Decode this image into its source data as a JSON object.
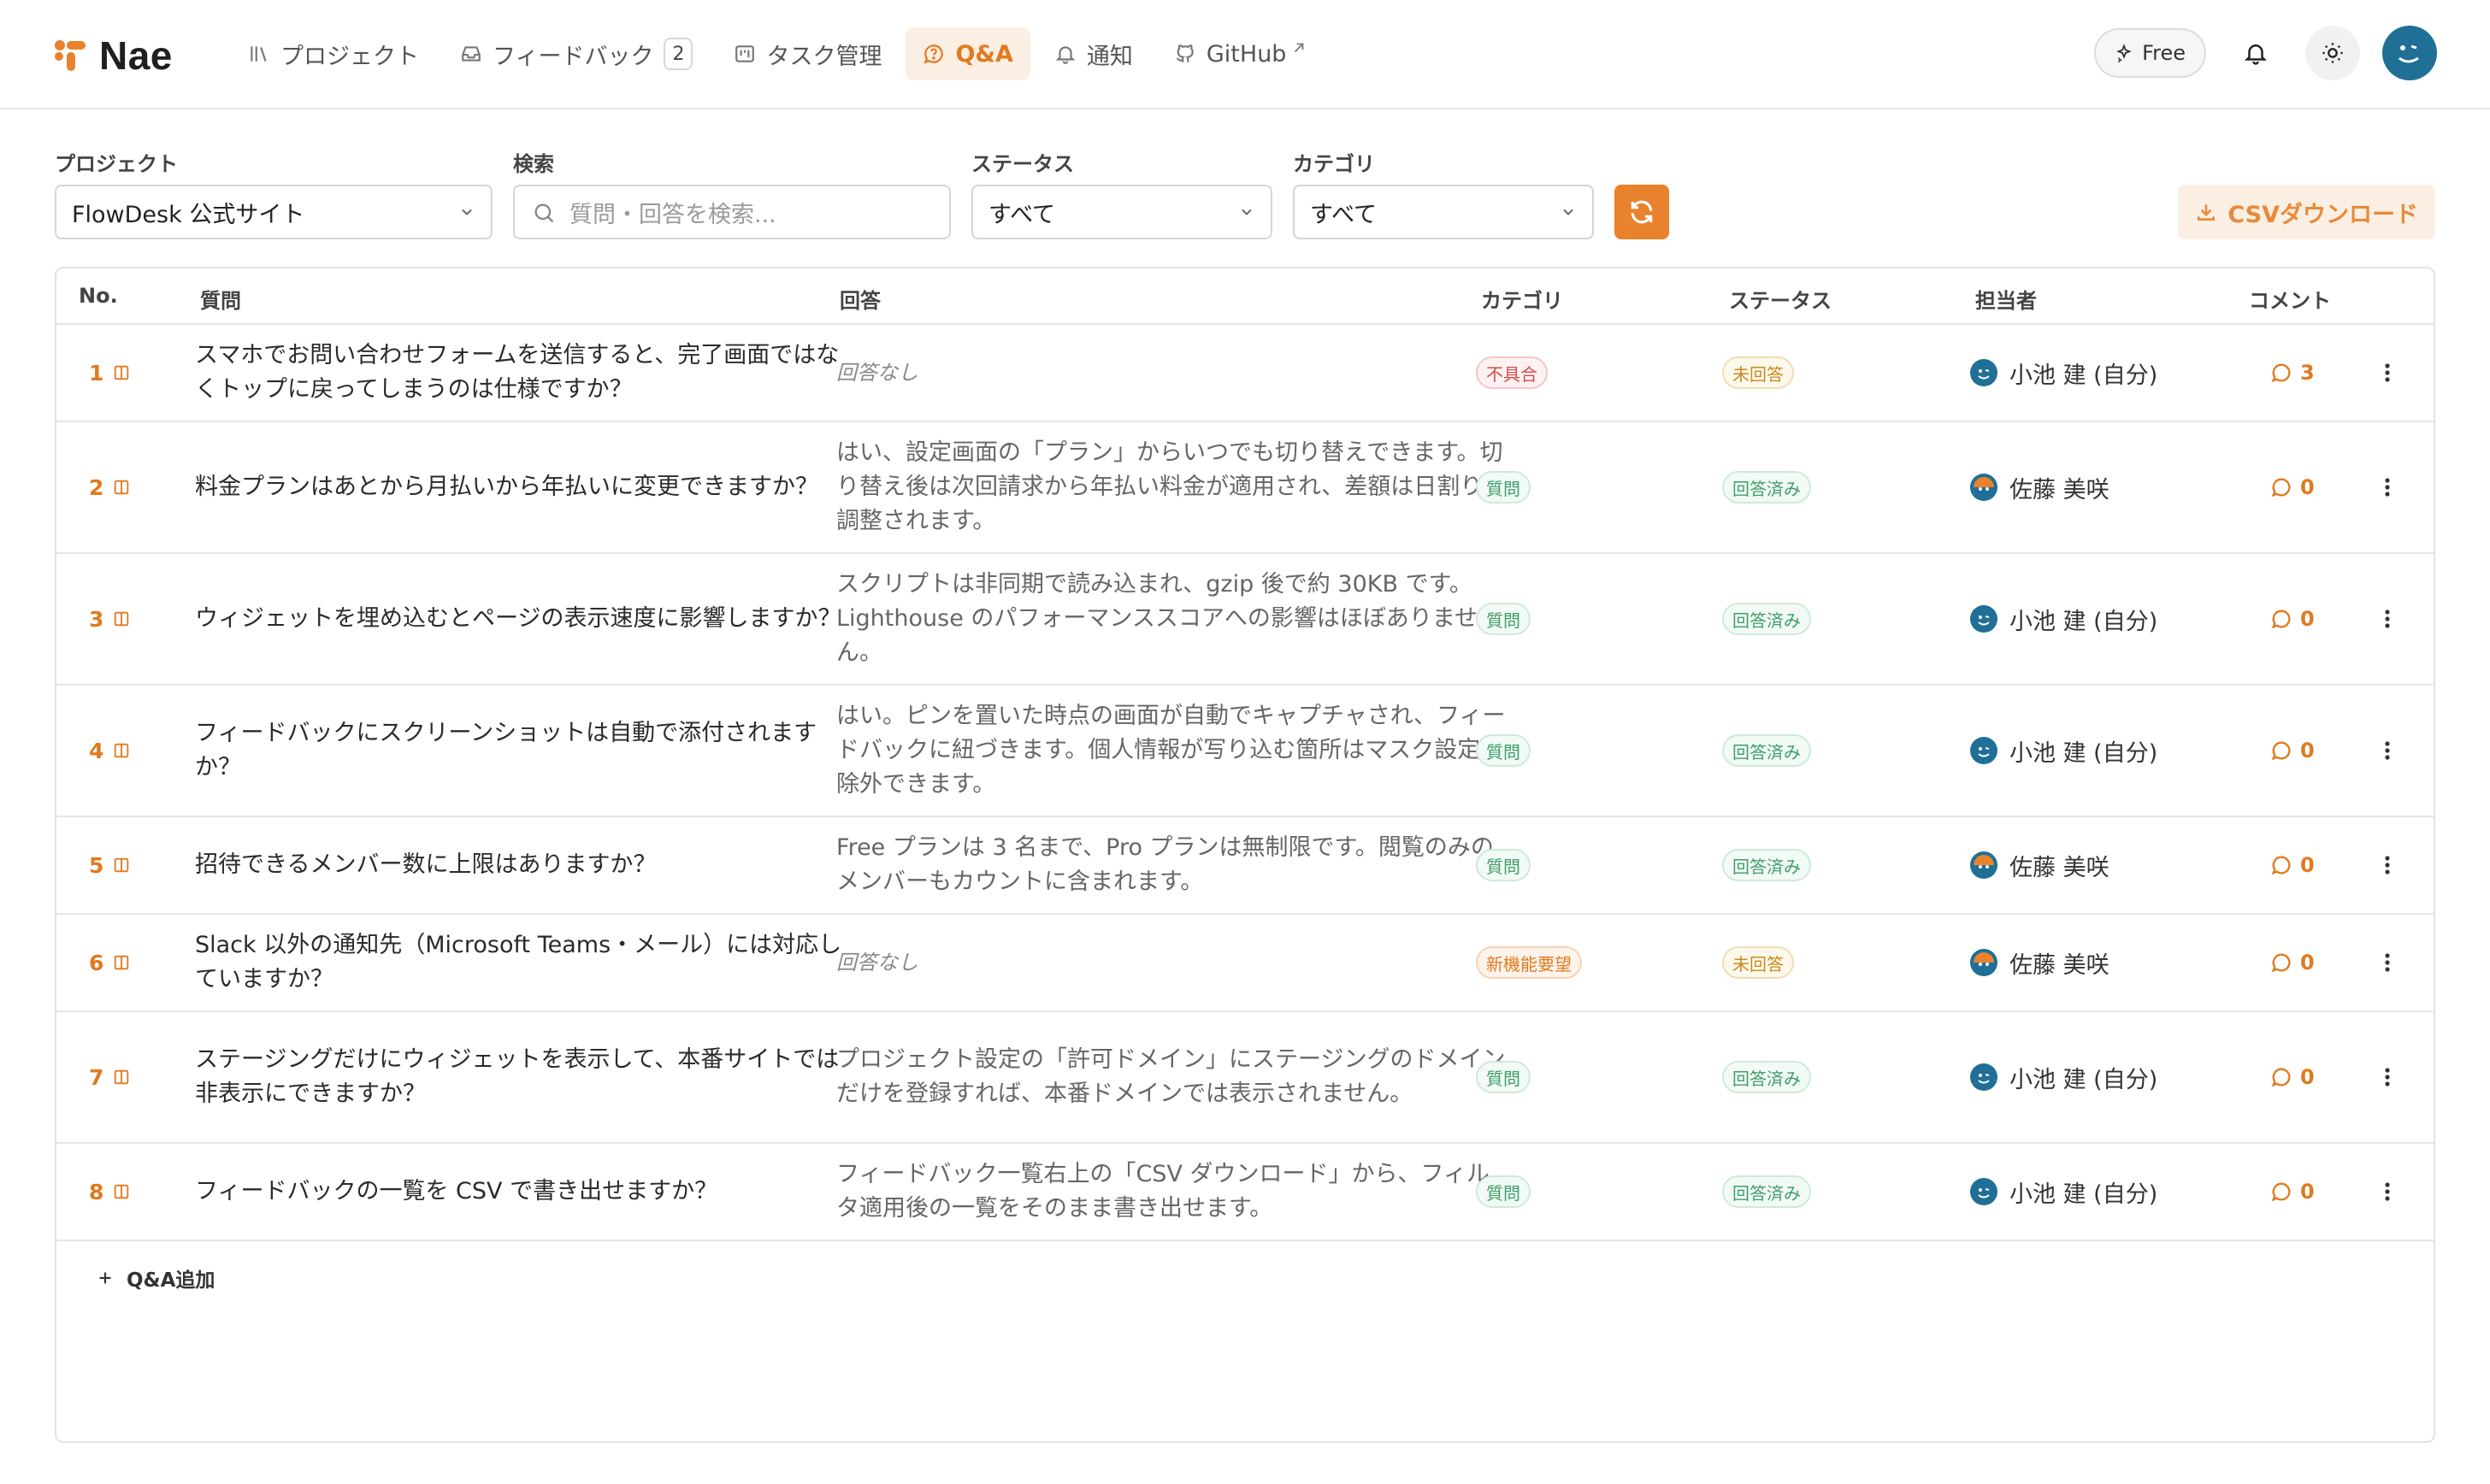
{
  "app": {
    "name": "Nae"
  },
  "nav": {
    "projects": "プロジェクト",
    "feedback": "フィードバック",
    "feedback_count": "2",
    "tasks": "タスク管理",
    "qa": "Q&A",
    "notifications": "通知",
    "github": "GitHub"
  },
  "header": {
    "plan": "Free"
  },
  "filters": {
    "project_label": "プロジェクト",
    "project_value": "FlowDesk 公式サイト",
    "search_label": "検索",
    "search_placeholder": "質問・回答を検索...",
    "status_label": "ステータス",
    "status_value": "すべて",
    "category_label": "カテゴリ",
    "category_value": "すべて",
    "csv_label": "CSVダウンロード"
  },
  "table": {
    "headers": {
      "no": "No.",
      "question": "質問",
      "answer": "回答",
      "category": "カテゴリ",
      "status": "ステータス",
      "assignee": "担当者",
      "comment": "コメント"
    },
    "rows": [
      {
        "no": "1",
        "question": "スマホでお問い合わせフォームを送信すると、完了画面ではなくトップに戻ってしまうのは仕様ですか？",
        "answer": "回答なし",
        "answer_empty": true,
        "category": "不具合",
        "category_tone": "red",
        "status": "未回答",
        "status_tone": "amber",
        "assignee": "小池 建 (自分)",
        "avatar": "blue",
        "comments": "3"
      },
      {
        "no": "2",
        "question": "料金プランはあとから月払いから年払いに変更できますか？",
        "answer": "はい、設定画面の「プラン」からいつでも切り替えできます。切り替え後は次回請求から年払い料金が適用され、差額は日割りで調整されます。",
        "answer_empty": false,
        "category": "質問",
        "category_tone": "green",
        "status": "回答済み",
        "status_tone": "green",
        "assignee": "佐藤 美咲",
        "avatar": "mix",
        "comments": "0"
      },
      {
        "no": "3",
        "question": "ウィジェットを埋め込むとページの表示速度に影響しますか？",
        "answer": "スクリプトは非同期で読み込まれ、gzip 後で約 30KB です。Lighthouse のパフォーマンススコアへの影響はほぼありません。",
        "answer_empty": false,
        "category": "質問",
        "category_tone": "green",
        "status": "回答済み",
        "status_tone": "green",
        "assignee": "小池 建 (自分)",
        "avatar": "blue",
        "comments": "0"
      },
      {
        "no": "4",
        "question": "フィードバックにスクリーンショットは自動で添付されますか？",
        "answer": "はい。ピンを置いた時点の画面が自動でキャプチャされ、フィードバックに紐づきます。個人情報が写り込む箇所はマスク設定で除外できます。",
        "answer_empty": false,
        "category": "質問",
        "category_tone": "green",
        "status": "回答済み",
        "status_tone": "green",
        "assignee": "小池 建 (自分)",
        "avatar": "blue",
        "comments": "0"
      },
      {
        "no": "5",
        "question": "招待できるメンバー数に上限はありますか？",
        "answer": "Free プランは 3 名まで、Pro プランは無制限です。閲覧のみのメンバーもカウントに含まれます。",
        "answer_empty": false,
        "category": "質問",
        "category_tone": "green",
        "status": "回答済み",
        "status_tone": "green",
        "assignee": "佐藤 美咲",
        "avatar": "mix",
        "comments": "0"
      },
      {
        "no": "6",
        "question": "Slack 以外の通知先（Microsoft Teams・メール）には対応していますか？",
        "answer": "回答なし",
        "answer_empty": true,
        "category": "新機能要望",
        "category_tone": "orange",
        "status": "未回答",
        "status_tone": "amber",
        "assignee": "佐藤 美咲",
        "avatar": "mix",
        "comments": "0"
      },
      {
        "no": "7",
        "question": "ステージングだけにウィジェットを表示して、本番サイトでは非表示にできますか？",
        "answer": "プロジェクト設定の「許可ドメイン」にステージングのドメインだけを登録すれば、本番ドメインでは表示されません。",
        "answer_empty": false,
        "category": "質問",
        "category_tone": "green",
        "status": "回答済み",
        "status_tone": "green",
        "assignee": "小池 建 (自分)",
        "avatar": "blue",
        "comments": "0"
      },
      {
        "no": "8",
        "question": "フィードバックの一覧を CSV で書き出せますか？",
        "answer": "フィードバック一覧右上の「CSV ダウンロード」から、フィルタ適用後の一覧をそのまま書き出せます。",
        "answer_empty": false,
        "category": "質問",
        "category_tone": "green",
        "status": "回答済み",
        "status_tone": "green",
        "assignee": "小池 建 (自分)",
        "avatar": "blue",
        "comments": "0"
      }
    ],
    "add_label": "Q&A追加"
  },
  "colors": {
    "accent": "#e8822c",
    "accent_text": "#e07a1f",
    "avatar": "#1f6f96"
  }
}
